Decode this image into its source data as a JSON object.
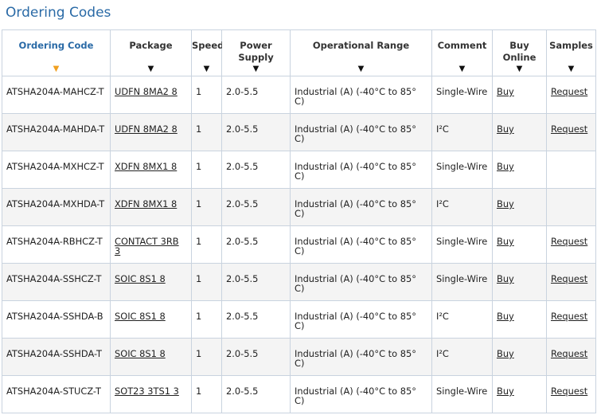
{
  "title": "Ordering Codes",
  "headers": {
    "code": "Ordering Code",
    "package": "Package",
    "speed": "Speed",
    "power": "Power Supply",
    "range": "Operational Range",
    "comment": "Comment",
    "buy": "Buy Online",
    "samples": "Samples",
    "sort_arrow": "▼"
  },
  "rows": [
    {
      "code": "ATSHA204A-MAHCZ-T",
      "package": "UDFN 8MA2 8",
      "speed": "1",
      "power": "2.0-5.5",
      "range": "Industrial (A) (-40°C to 85° C)",
      "comment": "Single-Wire",
      "buy": "Buy",
      "samples": "Request"
    },
    {
      "code": "ATSHA204A-MAHDA-T",
      "package": "UDFN 8MA2 8",
      "speed": "1",
      "power": "2.0-5.5",
      "range": "Industrial (A) (-40°C to 85° C)",
      "comment": "I²C",
      "buy": "Buy",
      "samples": "Request"
    },
    {
      "code": "ATSHA204A-MXHCZ-T",
      "package": "XDFN 8MX1 8",
      "speed": "1",
      "power": "2.0-5.5",
      "range": "Industrial (A) (-40°C to 85° C)",
      "comment": "Single-Wire",
      "buy": "Buy",
      "samples": ""
    },
    {
      "code": "ATSHA204A-MXHDA-T",
      "package": "XDFN 8MX1 8",
      "speed": "1",
      "power": "2.0-5.5",
      "range": "Industrial (A) (-40°C to 85° C)",
      "comment": "I²C",
      "buy": "Buy",
      "samples": ""
    },
    {
      "code": "ATSHA204A-RBHCZ-T",
      "package": "CONTACT 3RB 3",
      "speed": "1",
      "power": "2.0-5.5",
      "range": "Industrial (A) (-40°C to 85° C)",
      "comment": "Single-Wire",
      "buy": "Buy",
      "samples": "Request"
    },
    {
      "code": "ATSHA204A-SSHCZ-T",
      "package": "SOIC 8S1 8",
      "speed": "1",
      "power": "2.0-5.5",
      "range": "Industrial (A) (-40°C to 85° C)",
      "comment": "Single-Wire",
      "buy": "Buy",
      "samples": "Request"
    },
    {
      "code": "ATSHA204A-SSHDA-B",
      "package": "SOIC 8S1 8",
      "speed": "1",
      "power": "2.0-5.5",
      "range": "Industrial (A) (-40°C to 85° C)",
      "comment": "I²C",
      "buy": "Buy",
      "samples": "Request"
    },
    {
      "code": "ATSHA204A-SSHDA-T",
      "package": "SOIC 8S1 8",
      "speed": "1",
      "power": "2.0-5.5",
      "range": "Industrial (A) (-40°C to 85° C)",
      "comment": "I²C",
      "buy": "Buy",
      "samples": "Request"
    },
    {
      "code": "ATSHA204A-STUCZ-T",
      "package": "SOT23 3TS1 3",
      "speed": "1",
      "power": "2.0-5.5",
      "range": "Industrial (A) (-40°C to 85° C)",
      "comment": "Single-Wire",
      "buy": "Buy",
      "samples": "Request"
    }
  ],
  "colors": {
    "title": "#2a6aa6",
    "sort_arrow_active": "#f0a020",
    "border": "#c9d3df",
    "alt_row": "#f4f4f4"
  }
}
